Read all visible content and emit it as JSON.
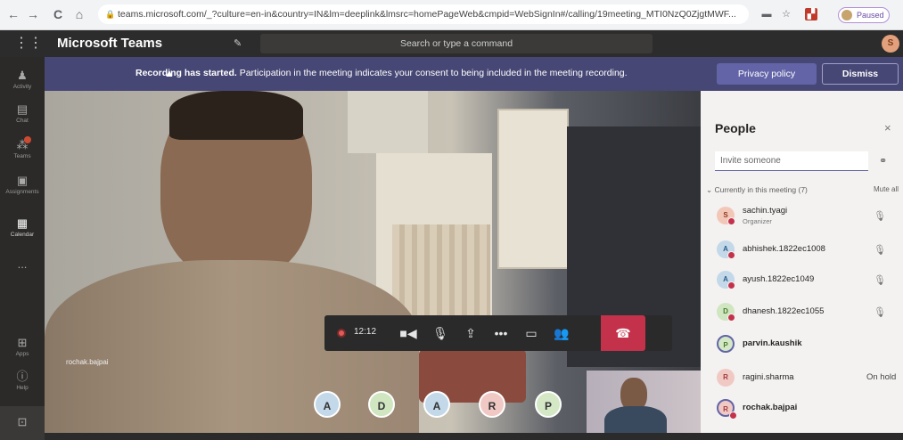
{
  "browser": {
    "back": "←",
    "forward": "→",
    "reload": "C",
    "home": "⌂",
    "url": "teams.microsoft.com/_?culture=en-in&country=IN&lm=deeplink&lmsrc=homePageWeb&cmpid=WebSignIn#/calling/19meeting_MTI0NzQ0ZjgtMWF...",
    "paused_label": "Paused"
  },
  "header": {
    "app_title": "Microsoft Teams",
    "search_placeholder": "Search or type a command",
    "me_initial": "S"
  },
  "rail": {
    "items": [
      {
        "label": "Activity",
        "icon": "bell-icon"
      },
      {
        "label": "Chat",
        "icon": "chat-icon"
      },
      {
        "label": "Teams",
        "icon": "teams-icon"
      },
      {
        "label": "Assignments",
        "icon": "assignments-icon"
      },
      {
        "label": "Calendar",
        "icon": "calendar-icon"
      },
      {
        "label": "...",
        "icon": "more-icon"
      },
      {
        "label": "Apps",
        "icon": "apps-icon"
      },
      {
        "label": "Help",
        "icon": "help-icon"
      }
    ]
  },
  "banner": {
    "bold": "Recording has started.",
    "text": " Participation in the meeting indicates your consent to being included in the meeting recording.",
    "privacy_button": "Privacy policy",
    "dismiss_button": "Dismiss"
  },
  "stage": {
    "speaker_name": "rochak.bajpai",
    "timer": "12:12",
    "bubbles": [
      {
        "initial": "A",
        "color": "#c3d8e8"
      },
      {
        "initial": "D",
        "color": "#cfe6c0"
      },
      {
        "initial": "A",
        "color": "#c3d8e8"
      },
      {
        "initial": "R",
        "color": "#f1c9c4"
      },
      {
        "initial": "P",
        "color": "#d4e8c6"
      }
    ]
  },
  "people": {
    "title": "People",
    "close": "×",
    "invite_placeholder": "Invite someone",
    "section": "Currently in this meeting (7)",
    "mute_all": "Mute all",
    "list": [
      {
        "initial": "S",
        "name": "sachin.tyagi",
        "sub": "Organizer",
        "state": "",
        "bold": false,
        "color": "#f3c7b7",
        "fg": "#8a3b1f",
        "mic": true
      },
      {
        "initial": "A",
        "name": "abhishek.1822ec1008",
        "sub": "",
        "state": "",
        "bold": false,
        "color": "#c3d8e8",
        "fg": "#2c5d8a",
        "mic": true
      },
      {
        "initial": "A",
        "name": "ayush.1822ec1049",
        "sub": "",
        "state": "",
        "bold": false,
        "color": "#c3d8e8",
        "fg": "#2c5d8a",
        "mic": true
      },
      {
        "initial": "D",
        "name": "dhanesh.1822ec1055",
        "sub": "",
        "state": "",
        "bold": false,
        "color": "#cfe6c0",
        "fg": "#4a7a2f",
        "mic": true
      },
      {
        "initial": "P",
        "name": "parvin.kaushik",
        "sub": "",
        "state": "",
        "bold": true,
        "color": "#d4e8c6",
        "fg": "#4a7a2f",
        "mic": false
      },
      {
        "initial": "R",
        "name": "ragini.sharma",
        "sub": "",
        "state": "On hold",
        "bold": false,
        "color": "#f1c9c4",
        "fg": "#a13b3b",
        "mic": false
      },
      {
        "initial": "R",
        "name": "rochak.bajpai",
        "sub": "",
        "state": "",
        "bold": true,
        "color": "#f1c9c4",
        "fg": "#a13b3b",
        "mic": false
      }
    ]
  }
}
